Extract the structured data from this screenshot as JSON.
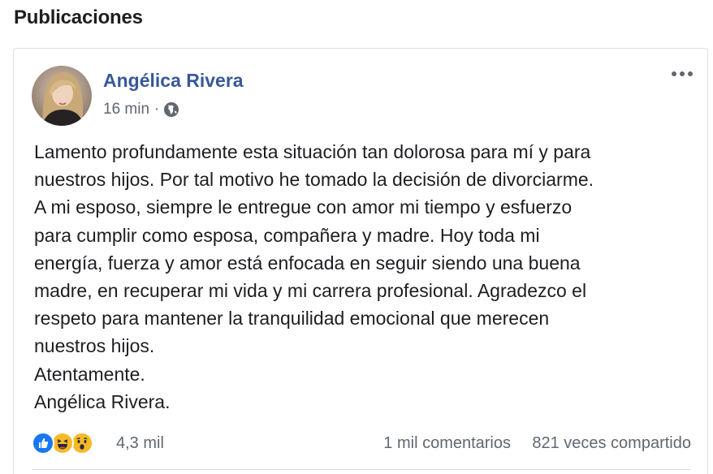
{
  "section": {
    "title": "Publicaciones"
  },
  "post": {
    "author": "Angélica Rivera",
    "time": "16 min",
    "separator": "·",
    "privacy_icon": "globe-icon",
    "more_icon": "more-options-icon",
    "lines": [
      "Lamento profundamente esta situación tan dolorosa para mí y para",
      "nuestros hijos. Por tal motivo he tomado la decisión de divorciarme.",
      "A mi esposo, siempre le entregue con amor mi tiempo y esfuerzo",
      "para cumplir como esposa, compañera y madre. Hoy toda mi",
      "energía, fuerza y amor está enfocada en seguir siendo una buena",
      "madre, en recuperar mi vida y mi carrera profesional. Agradezco el",
      "respeto para mantener la tranquilidad emocional que merecen",
      "nuestros hijos.",
      "Atentamente.",
      "Angélica Rivera."
    ],
    "reactions": {
      "icons": [
        "like-icon",
        "haha-icon",
        "wow-icon"
      ],
      "count": "4,3 mil"
    },
    "comments": "1 mil comentarios",
    "shares": "821 veces compartido"
  },
  "colors": {
    "link_blue": "#385898",
    "text": "#1c1e21",
    "secondary": "#616770",
    "like_blue": "#1877f2",
    "emoji_yellow": "#f7b928"
  }
}
